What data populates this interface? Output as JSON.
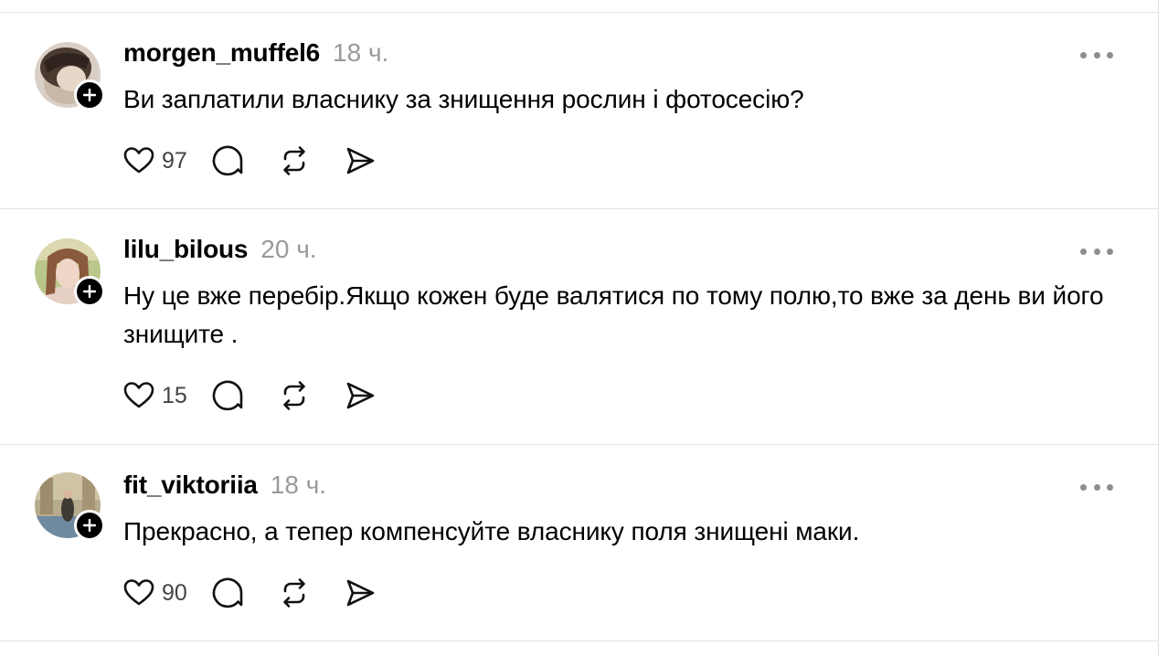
{
  "posts": [
    {
      "username": "morgen_muffel6",
      "time": "18 ч.",
      "text": "Ви заплатили власнику за знищення рослин і фотосесію?",
      "likes": "97"
    },
    {
      "username": "lilu_bilous",
      "time": "20 ч.",
      "text": "Ну це вже перебір.Якщо кожен буде валятися по тому полю,то вже за день ви його знищите .",
      "likes": "15"
    },
    {
      "username": "fit_viktoriia",
      "time": "18 ч.",
      "text": "Прекрасно, а тепер компенсуйте власнику поля знищені маки.",
      "likes": "90"
    }
  ],
  "icons": {
    "like": "heart-icon",
    "reply": "comment-icon",
    "repost": "repost-icon",
    "share": "send-icon",
    "more": "more-options-icon",
    "follow": "plus-icon"
  },
  "colors": {
    "text": "#000000",
    "muted": "#9a9a9a",
    "divider": "#e3e3e3"
  }
}
